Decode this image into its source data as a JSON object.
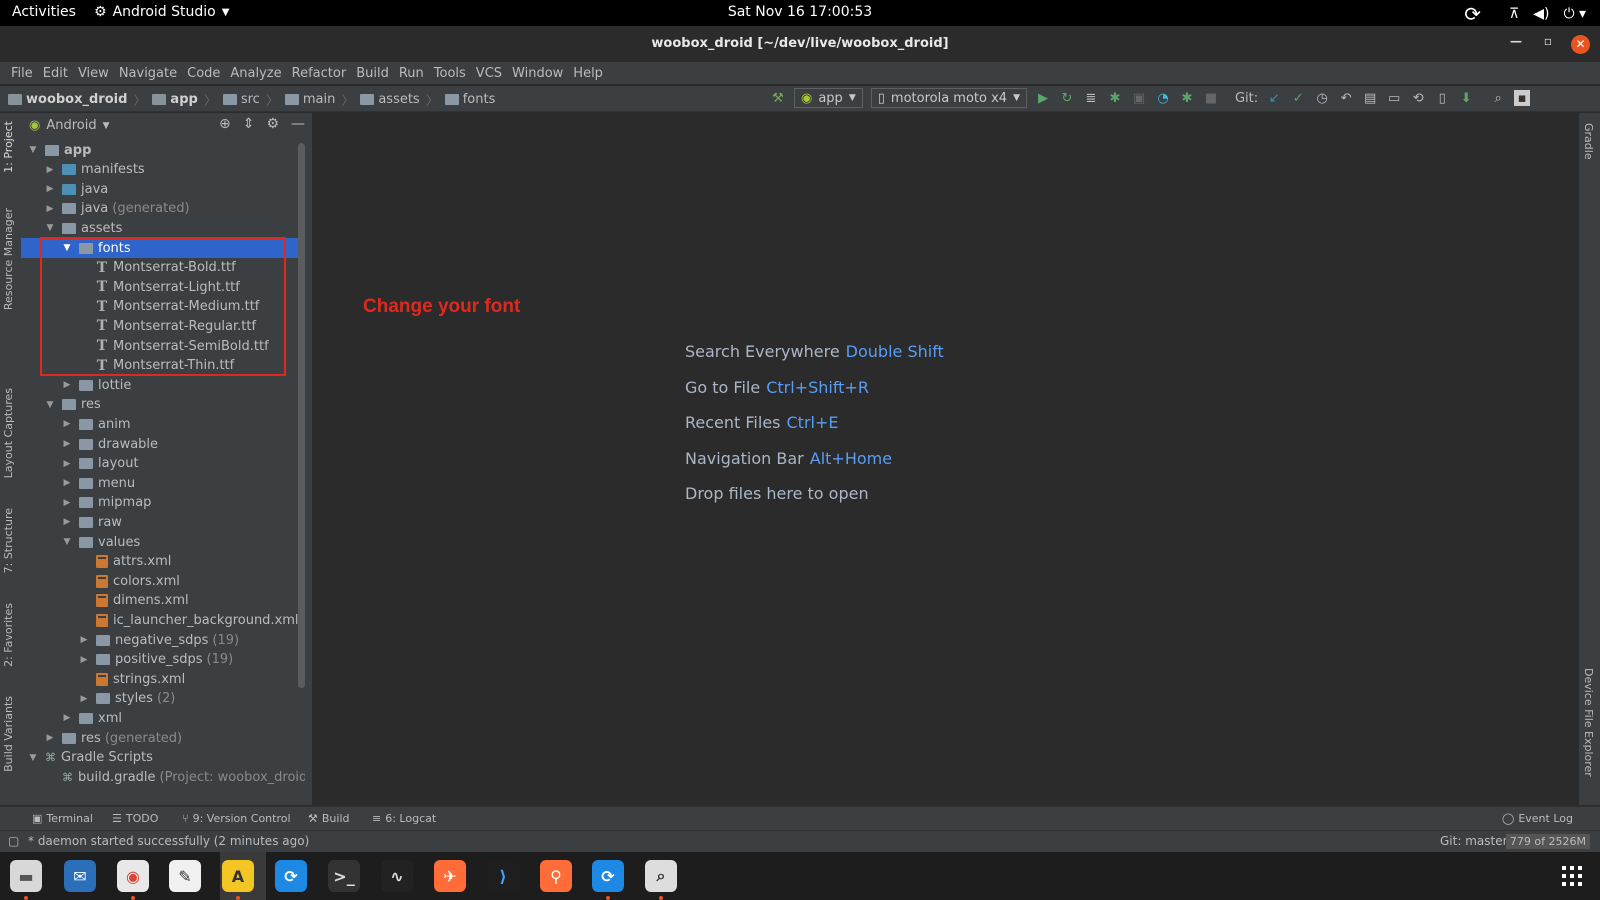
{
  "topbar": {
    "activities": "Activities",
    "app_name": "Android Studio",
    "clock": "Sat Nov 16  17:00:53"
  },
  "window": {
    "title": "woobox_droid [~/dev/live/woobox_droid]"
  },
  "menu": [
    "File",
    "Edit",
    "View",
    "Navigate",
    "Code",
    "Analyze",
    "Refactor",
    "Build",
    "Run",
    "Tools",
    "VCS",
    "Window",
    "Help"
  ],
  "breadcrumbs": [
    "woobox_droid",
    "app",
    "src",
    "main",
    "assets",
    "fonts"
  ],
  "toolbar": {
    "run_config": "app",
    "device": "motorola moto x4",
    "git_label": "Git:"
  },
  "left_tabs": [
    "1: Project",
    "Resource Manager",
    "Layout Captures",
    "7: Structure",
    "2: Favorites",
    "Build Variants"
  ],
  "right_tabs": [
    "Gradle",
    "Device File Explorer"
  ],
  "project_panel": {
    "view_selector": "Android",
    "tree": [
      {
        "label": "app",
        "extra": "",
        "depth": 0,
        "arrow": "open",
        "icon": "module"
      },
      {
        "label": "manifests",
        "extra": "",
        "depth": 1,
        "arrow": "closed",
        "icon": "folder-blue"
      },
      {
        "label": "java",
        "extra": "",
        "depth": 1,
        "arrow": "closed",
        "icon": "folder-blue"
      },
      {
        "label": "java",
        "extra": "(generated)",
        "depth": 1,
        "arrow": "closed",
        "icon": "folder-gen"
      },
      {
        "label": "assets",
        "extra": "",
        "depth": 1,
        "arrow": "open",
        "icon": "folder"
      },
      {
        "label": "fonts",
        "extra": "",
        "depth": 2,
        "arrow": "open",
        "icon": "folder",
        "selected": true
      },
      {
        "label": "Montserrat-Bold.ttf",
        "extra": "",
        "depth": 3,
        "arrow": "none",
        "icon": "font"
      },
      {
        "label": "Montserrat-Light.ttf",
        "extra": "",
        "depth": 3,
        "arrow": "none",
        "icon": "font"
      },
      {
        "label": "Montserrat-Medium.ttf",
        "extra": "",
        "depth": 3,
        "arrow": "none",
        "icon": "font"
      },
      {
        "label": "Montserrat-Regular.ttf",
        "extra": "",
        "depth": 3,
        "arrow": "none",
        "icon": "font"
      },
      {
        "label": "Montserrat-SemiBold.ttf",
        "extra": "",
        "depth": 3,
        "arrow": "none",
        "icon": "font"
      },
      {
        "label": "Montserrat-Thin.ttf",
        "extra": "",
        "depth": 3,
        "arrow": "none",
        "icon": "font"
      },
      {
        "label": "lottie",
        "extra": "",
        "depth": 2,
        "arrow": "closed",
        "icon": "folder"
      },
      {
        "label": "res",
        "extra": "",
        "depth": 1,
        "arrow": "open",
        "icon": "folder"
      },
      {
        "label": "anim",
        "extra": "",
        "depth": 2,
        "arrow": "closed",
        "icon": "folder"
      },
      {
        "label": "drawable",
        "extra": "",
        "depth": 2,
        "arrow": "closed",
        "icon": "folder"
      },
      {
        "label": "layout",
        "extra": "",
        "depth": 2,
        "arrow": "closed",
        "icon": "folder"
      },
      {
        "label": "menu",
        "extra": "",
        "depth": 2,
        "arrow": "closed",
        "icon": "folder"
      },
      {
        "label": "mipmap",
        "extra": "",
        "depth": 2,
        "arrow": "closed",
        "icon": "folder"
      },
      {
        "label": "raw",
        "extra": "",
        "depth": 2,
        "arrow": "closed",
        "icon": "folder"
      },
      {
        "label": "values",
        "extra": "",
        "depth": 2,
        "arrow": "open",
        "icon": "folder"
      },
      {
        "label": "attrs.xml",
        "extra": "",
        "depth": 3,
        "arrow": "none",
        "icon": "xml"
      },
      {
        "label": "colors.xml",
        "extra": "",
        "depth": 3,
        "arrow": "none",
        "icon": "xml"
      },
      {
        "label": "dimens.xml",
        "extra": "",
        "depth": 3,
        "arrow": "none",
        "icon": "xml"
      },
      {
        "label": "ic_launcher_background.xml",
        "extra": "",
        "depth": 3,
        "arrow": "none",
        "icon": "xml"
      },
      {
        "label": "negative_sdps",
        "extra": "(19)",
        "depth": 3,
        "arrow": "closed",
        "icon": "folder"
      },
      {
        "label": "positive_sdps",
        "extra": "(19)",
        "depth": 3,
        "arrow": "closed",
        "icon": "folder"
      },
      {
        "label": "strings.xml",
        "extra": "",
        "depth": 3,
        "arrow": "none",
        "icon": "xml"
      },
      {
        "label": "styles",
        "extra": "(2)",
        "depth": 3,
        "arrow": "closed",
        "icon": "folder"
      },
      {
        "label": "xml",
        "extra": "",
        "depth": 2,
        "arrow": "closed",
        "icon": "folder"
      },
      {
        "label": "res",
        "extra": "(generated)",
        "depth": 1,
        "arrow": "closed",
        "icon": "folder-gen"
      },
      {
        "label": "Gradle Scripts",
        "extra": "",
        "depth": 0,
        "arrow": "open",
        "icon": "gradle"
      },
      {
        "label": "build.gradle",
        "extra": "(Project: woobox_droid)",
        "depth": 1,
        "arrow": "none",
        "icon": "gradle"
      }
    ]
  },
  "editor": {
    "annotation": "Change your font",
    "hints": [
      {
        "text": "Search Everywhere",
        "key": "Double Shift"
      },
      {
        "text": "Go to File",
        "key": "Ctrl+Shift+R"
      },
      {
        "text": "Recent Files",
        "key": "Ctrl+E"
      },
      {
        "text": "Navigation Bar",
        "key": "Alt+Home"
      },
      {
        "text": "Drop files here to open",
        "key": ""
      }
    ]
  },
  "bottom_tabs": [
    "Terminal",
    "TODO",
    "9: Version Control",
    "Build",
    "6: Logcat"
  ],
  "event_log": "Event Log",
  "status": {
    "message": "* daemon started successfully (2 minutes ago)",
    "git": "Git: master",
    "memory": "779 of 2526M"
  },
  "colors": {
    "selection": "#2f65ca",
    "annotation_red": "#e0281e",
    "shortcut_blue": "#589df6",
    "ubuntu_orange": "#e95420"
  },
  "dock_apps": [
    "files-icon",
    "thunderbird-icon",
    "chrome-icon",
    "text-editor-icon",
    "android-studio-icon",
    "clock-app-icon",
    "terminal-icon",
    "system-monitor-icon",
    "postman-icon",
    "vscode-icon",
    "api-tool-icon",
    "updater-icon",
    "screenshot-icon"
  ]
}
